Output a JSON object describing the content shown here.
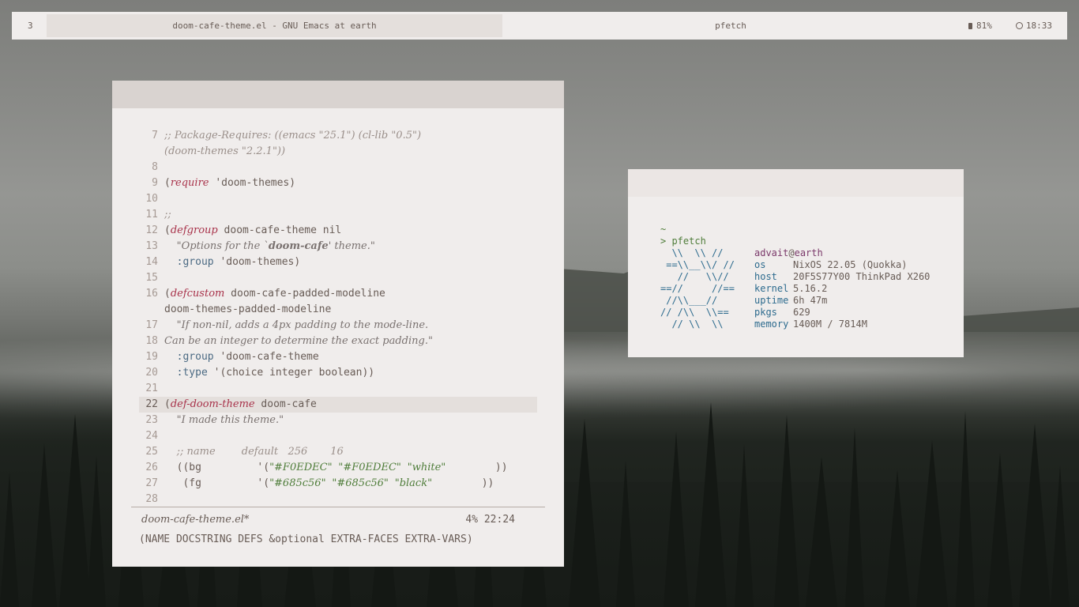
{
  "topbar": {
    "workspace": "3",
    "window_title": "doom-cafe-theme.el - GNU Emacs at earth",
    "center_title": "pfetch",
    "battery": "81%",
    "clock": "18:33"
  },
  "emacs": {
    "lines": [
      {
        "n": "7",
        "html": "<span class='cmt'>;; Package-Requires: ((emacs \"25.1\") (cl-lib \"0.5\")</span>"
      },
      {
        "n": "",
        "html": "<span class='cmt'>(doom-themes \"2.2.1\"))</span>"
      },
      {
        "n": "8",
        "html": ""
      },
      {
        "n": "9",
        "html": "(<span class='kw'>require</span> 'doom-themes)"
      },
      {
        "n": "10",
        "html": ""
      },
      {
        "n": "11",
        "html": "<span class='cmt'>;;</span>"
      },
      {
        "n": "12",
        "html": "(<span class='kw'>defgroup</span> doom-cafe-theme nil"
      },
      {
        "n": "13",
        "html": "  <span class='str'>\"Options for the `<b>doom-cafe</b>' theme.\"</span>"
      },
      {
        "n": "14",
        "html": "  <span class='cst'>:group</span> 'doom-themes)"
      },
      {
        "n": "15",
        "html": ""
      },
      {
        "n": "16",
        "html": "(<span class='kw'>defcustom</span> doom-cafe-padded-modeline"
      },
      {
        "n": "",
        "html": "doom-themes-padded-modeline"
      },
      {
        "n": "17",
        "html": "  <span class='str'>\"If non-nil, adds a 4px padding to the mode-line.</span>"
      },
      {
        "n": "18",
        "html": "<span class='str'>Can be an integer to determine the exact padding.\"</span>"
      },
      {
        "n": "19",
        "html": "  <span class='cst'>:group</span> 'doom-cafe-theme"
      },
      {
        "n": "20",
        "html": "  <span class='cst'>:type</span> '(choice integer boolean))"
      },
      {
        "n": "21",
        "html": ""
      },
      {
        "n": "22",
        "html": "(<span class='kw'>def-doom-theme</span> doom-cafe",
        "hl": true
      },
      {
        "n": "23",
        "html": "  <span class='str'>\"I made this theme.\"</span>"
      },
      {
        "n": "24",
        "html": ""
      },
      {
        "n": "25",
        "html": "  <span class='cmt'>;; name        default   256       16</span>"
      },
      {
        "n": "26",
        "html": "  ((bg         '(<span class='strg'>\"#F0EDEC\"</span> <span class='strg'>\"#F0EDEC\"</span> <span class='strg'>\"white\"</span>        ))"
      },
      {
        "n": "27",
        "html": "   (fg         '(<span class='strg'>\"#685c56\"</span> <span class='strg'>\"#685c56\"</span> <span class='strg'>\"black\"</span>        ))"
      },
      {
        "n": "28",
        "html": ""
      }
    ],
    "modeline_buffer": "doom-cafe-theme.el*",
    "modeline_position": "4% 22:24",
    "echo_area": "(NAME DOCSTRING DEFS &optional EXTRA-FACES EXTRA-VARS)"
  },
  "terminal": {
    "tilde": "~",
    "prompt": "> pfetch",
    "logo": [
      "  \\\\  \\\\ //",
      " ==\\\\__\\\\/ //",
      "   //   \\\\//",
      "==//     //==",
      " //\\\\___//",
      "// /\\\\  \\\\==",
      "  // \\\\  \\\\"
    ],
    "user": "advait",
    "at": "@",
    "host_name": "earth",
    "info": [
      {
        "key": "os",
        "value": "NixOS 22.05 (Quokka)"
      },
      {
        "key": "host",
        "value": "20F5S77Y00 ThinkPad X260"
      },
      {
        "key": "kernel",
        "value": "5.16.2"
      },
      {
        "key": "uptime",
        "value": "6h 47m"
      },
      {
        "key": "pkgs",
        "value": "629"
      },
      {
        "key": "memory",
        "value": "1400M / 7814M"
      }
    ]
  },
  "colors": {
    "bg": "#F0EDEC",
    "fg": "#685c56",
    "keyword": "#a8324a",
    "string": "#4f7d3a",
    "constant": "#2d6b8e"
  }
}
